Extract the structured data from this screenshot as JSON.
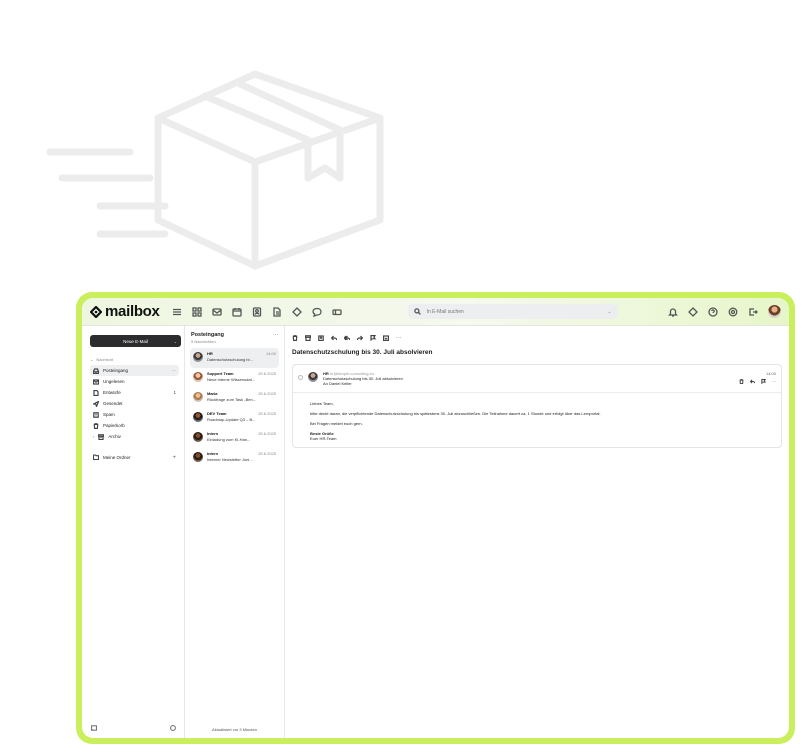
{
  "topbar": {
    "logo_text": "mailbox",
    "search_placeholder": "In E-Mail suchen",
    "app_icons": [
      "menu-icon",
      "grid-icon",
      "mail-icon",
      "calendar-icon",
      "contacts-icon",
      "files-icon",
      "tag-icon",
      "chat-icon",
      "ticket-icon"
    ],
    "right_icons": [
      "bell-icon",
      "diamond-icon",
      "help-icon",
      "settings-icon",
      "logout-icon",
      "avatar"
    ]
  },
  "sidebar": {
    "new_mail_label": "Neue E-Mail",
    "account_label": "Nachricht",
    "items": [
      {
        "label": "Posteingang",
        "icon": "inbox-icon",
        "count": "",
        "active": true
      },
      {
        "label": "Ungelesen",
        "icon": "mail-icon",
        "count": ""
      },
      {
        "label": "Entwürfe",
        "icon": "draft-icon",
        "count": "1"
      },
      {
        "label": "Gesendet",
        "icon": "send-icon",
        "count": ""
      },
      {
        "label": "Spam",
        "icon": "spam-icon",
        "count": ""
      },
      {
        "label": "Papierkorb",
        "icon": "trash-icon",
        "count": ""
      },
      {
        "label": "Archiv",
        "icon": "archive-icon",
        "count": ""
      }
    ],
    "my_folders_label": "Meine Ordner"
  },
  "message_list": {
    "title": "Posteingang",
    "subtitle": "5 Nachrichten",
    "footer": "Aktualisiert vor 3 Minuten",
    "messages": [
      {
        "from": "HR",
        "date": "14:00",
        "subject": "Datenschutzschulung bi..."
      },
      {
        "from": "Support Team",
        "date": "29.6.2025",
        "subject": "Neue interne Wissensdat..."
      },
      {
        "from": "Maria",
        "date": "25.6.2025",
        "subject": "Rückfrage zum Task „Ben..."
      },
      {
        "from": "DEV Team",
        "date": "25.6.2025",
        "subject": "Roadmap-Update Q3 – B..."
      },
      {
        "from": "Intern",
        "date": "25.6.2025",
        "subject": "Einladung zum KI-Han..."
      },
      {
        "from": "Intern",
        "date": "25.6.2025",
        "subject": "Interner Newsletter Juni..."
      }
    ]
  },
  "reader": {
    "subject": "Datenschutzschulung bis 30. Juli absolvieren",
    "sender_name": "HR",
    "sender_address": "hr@simple-consulting.eu",
    "header_subject": "Datenschutzschulung bis 30. Juli absolvieren",
    "to_line": "An Daniel Keller",
    "time": "14:00",
    "body": {
      "greeting": "Liebes Team,",
      "paragraph1": "bitte denkt daran, die verpflichtende Datenschutzschulung bis spätestens 30. Juli abzuschließen. Die Teilnahme dauert ca. 1 Stunde und erfolgt über das Lernportal.",
      "paragraph2": "Bei Fragen meldet euch gern.",
      "closing1": "Beste Grüße",
      "closing2": "Euer HR-Team"
    }
  },
  "colors": {
    "frame_green": "#c9ef5c",
    "new_mail_button": "#2c2c2e"
  }
}
